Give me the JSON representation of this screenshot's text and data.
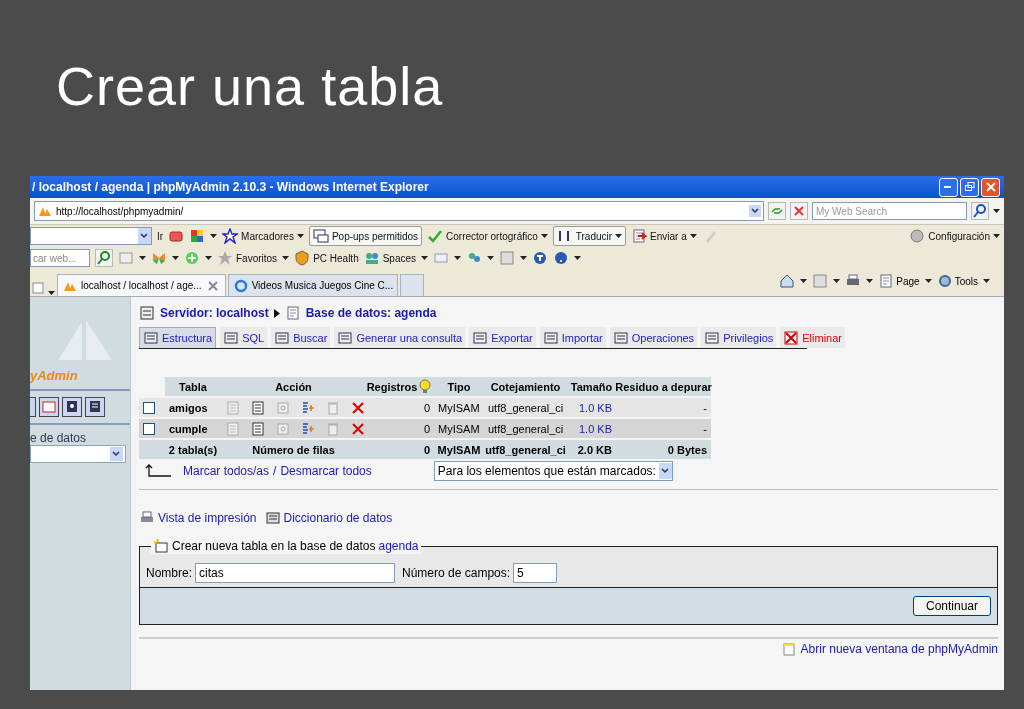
{
  "slide": {
    "title": "Crear una tabla"
  },
  "browser": {
    "title": "/ localhost / agenda | phpMyAdmin 2.10.3 - Windows Internet Explorer",
    "address": "http://localhost/phpmyadmin/",
    "search_placeholder": "My Web Search"
  },
  "toolbar": {
    "go": "Ir",
    "bookmarks": "Marcadores",
    "popups": "Pop-ups permitidos",
    "spellcheck": "Corrector ortográfico",
    "translate": "Traducir",
    "send": "Enviar a",
    "settings": "Configuración"
  },
  "links_bar": {
    "search_placeholder": "car web...",
    "favorites": "Favoritos",
    "pc_health": "PC Health",
    "spaces": "Spaces"
  },
  "browser_tabs": [
    {
      "label": "localhost / localhost / age...",
      "selected": true
    },
    {
      "label": "Videos Musica Juegos Cine C...",
      "selected": false
    }
  ],
  "command_bar": {
    "page": "Page",
    "tools": "Tools"
  },
  "sidebar": {
    "logo": "yAdmin",
    "database_label": "e de datos"
  },
  "breadcrumb": {
    "server": "Servidor: localhost",
    "database": "Base de datos: agenda"
  },
  "tabs": [
    {
      "label": "Estructura",
      "selected": true,
      "kind": "normal"
    },
    {
      "label": "SQL",
      "selected": false,
      "kind": "normal"
    },
    {
      "label": "Buscar",
      "selected": false,
      "kind": "normal"
    },
    {
      "label": "Generar una consulta",
      "selected": false,
      "kind": "normal"
    },
    {
      "label": "Exportar",
      "selected": false,
      "kind": "normal"
    },
    {
      "label": "Importar",
      "selected": false,
      "kind": "normal"
    },
    {
      "label": "Operaciones",
      "selected": false,
      "kind": "normal"
    },
    {
      "label": "Privilegios",
      "selected": false,
      "kind": "normal"
    },
    {
      "label": "Eliminar",
      "selected": false,
      "kind": "danger"
    }
  ],
  "table": {
    "columns": [
      "Tabla",
      "Acción",
      "Registros",
      "Tipo",
      "Cotejamiento",
      "Tamaño",
      "Residuo a depurar"
    ],
    "rows": [
      {
        "checked": false,
        "name": "amigos",
        "records": "0",
        "type": "MyISAM",
        "collation": "utf8_general_ci",
        "size": "1.0 KB",
        "overhead": "-"
      },
      {
        "checked": false,
        "name": "cumple",
        "records": "0",
        "type": "MyISAM",
        "collation": "utf8_general_ci",
        "size": "1.0 KB",
        "overhead": "-"
      }
    ],
    "footer": [
      "2 tabla(s)",
      "Número de filas",
      "0",
      "MyISAM",
      "utf8_general_ci",
      "2.0 KB",
      "0 Bytes"
    ]
  },
  "mark_all": "Marcar todos/as",
  "separator": "/",
  "unmark_all": "Desmarcar todos",
  "with_selected": "Para los elementos que están marcados:",
  "links": [
    "Vista de impresión",
    "Diccionario de datos"
  ],
  "create": {
    "legend": "Crear nueva tabla en la base de datos",
    "database": "agenda",
    "name_label": "Nombre:",
    "name_value": "citas",
    "fields_label": "Número de campos:",
    "fields_value": "5",
    "button": "Continuar"
  },
  "new_window": "Abrir nueva ventana de phpMyAdmin"
}
